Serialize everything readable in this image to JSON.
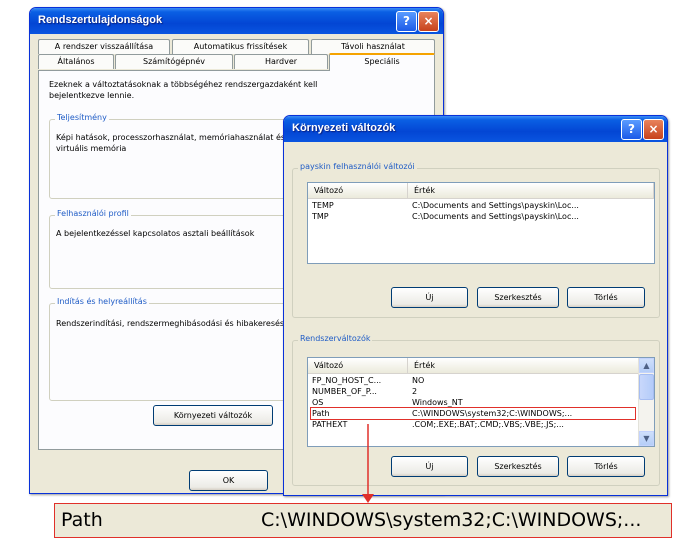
{
  "sysprops": {
    "title": "Rendszertulajdonságok",
    "help_icon": "?",
    "close_icon": "×",
    "tabs_row1": [
      "A rendszer visszaállítása",
      "Automatikus frissítések",
      "Távoli használat"
    ],
    "tabs_row2": [
      "Általános",
      "Számítógépnév",
      "Hardver",
      "Speciális"
    ],
    "intro": "Ezeknek a változtatásoknak a többségéhez rendszergazdaként kell bejelentkezve lennie.",
    "groups": [
      {
        "label": "Teljesítmény",
        "text": "Képi hatások, processzorhasználat, memóriahasználat és virtuális memória"
      },
      {
        "label": "Felhasználói profil",
        "text": "A bejelentkezéssel kapcsolatos asztali beállítások"
      },
      {
        "label": "Indítás és helyreállítás",
        "text": "Rendszerindítási, rendszermeghibásodási és hibakeresési adatok"
      }
    ],
    "env_button": "Környezeti változók",
    "ok_button": "OK"
  },
  "envvars": {
    "title": "Környezeti változók",
    "help_icon": "?",
    "close_icon": "×",
    "user_group_label": "payskin felhasználói változói",
    "col_variable": "Változó",
    "col_value": "Érték",
    "user_rows": [
      {
        "name": "TEMP",
        "value": "C:\\Documents and Settings\\payskin\\Loc..."
      },
      {
        "name": "TMP",
        "value": "C:\\Documents and Settings\\payskin\\Loc..."
      }
    ],
    "buttons_user": {
      "new": "Új",
      "edit": "Szerkesztés",
      "delete": "Törlés"
    },
    "sys_group_label": "Rendszerváltozók",
    "sys_rows": [
      {
        "name": "FP_NO_HOST_C...",
        "value": "NO"
      },
      {
        "name": "NUMBER_OF_P...",
        "value": "2"
      },
      {
        "name": "OS",
        "value": "Windows_NT"
      },
      {
        "name": "Path",
        "value": "C:\\WINDOWS\\system32;C:\\WINDOWS;..."
      },
      {
        "name": "PATHEXT",
        "value": ".COM;.EXE;.BAT;.CMD;.VBS;.VBE;.JS;..."
      }
    ],
    "buttons_sys": {
      "new": "Új",
      "edit": "Szerkesztés",
      "delete": "Törlés"
    },
    "scroll_up": "▲",
    "scroll_down": "▼"
  },
  "zoom": {
    "name": "Path",
    "value": "C:\\WINDOWS\\system32;C:\\WINDOWS;..."
  },
  "colors": {
    "accent": "#0a5fe4",
    "highlight": "#e0302a",
    "face": "#ece9d8"
  }
}
